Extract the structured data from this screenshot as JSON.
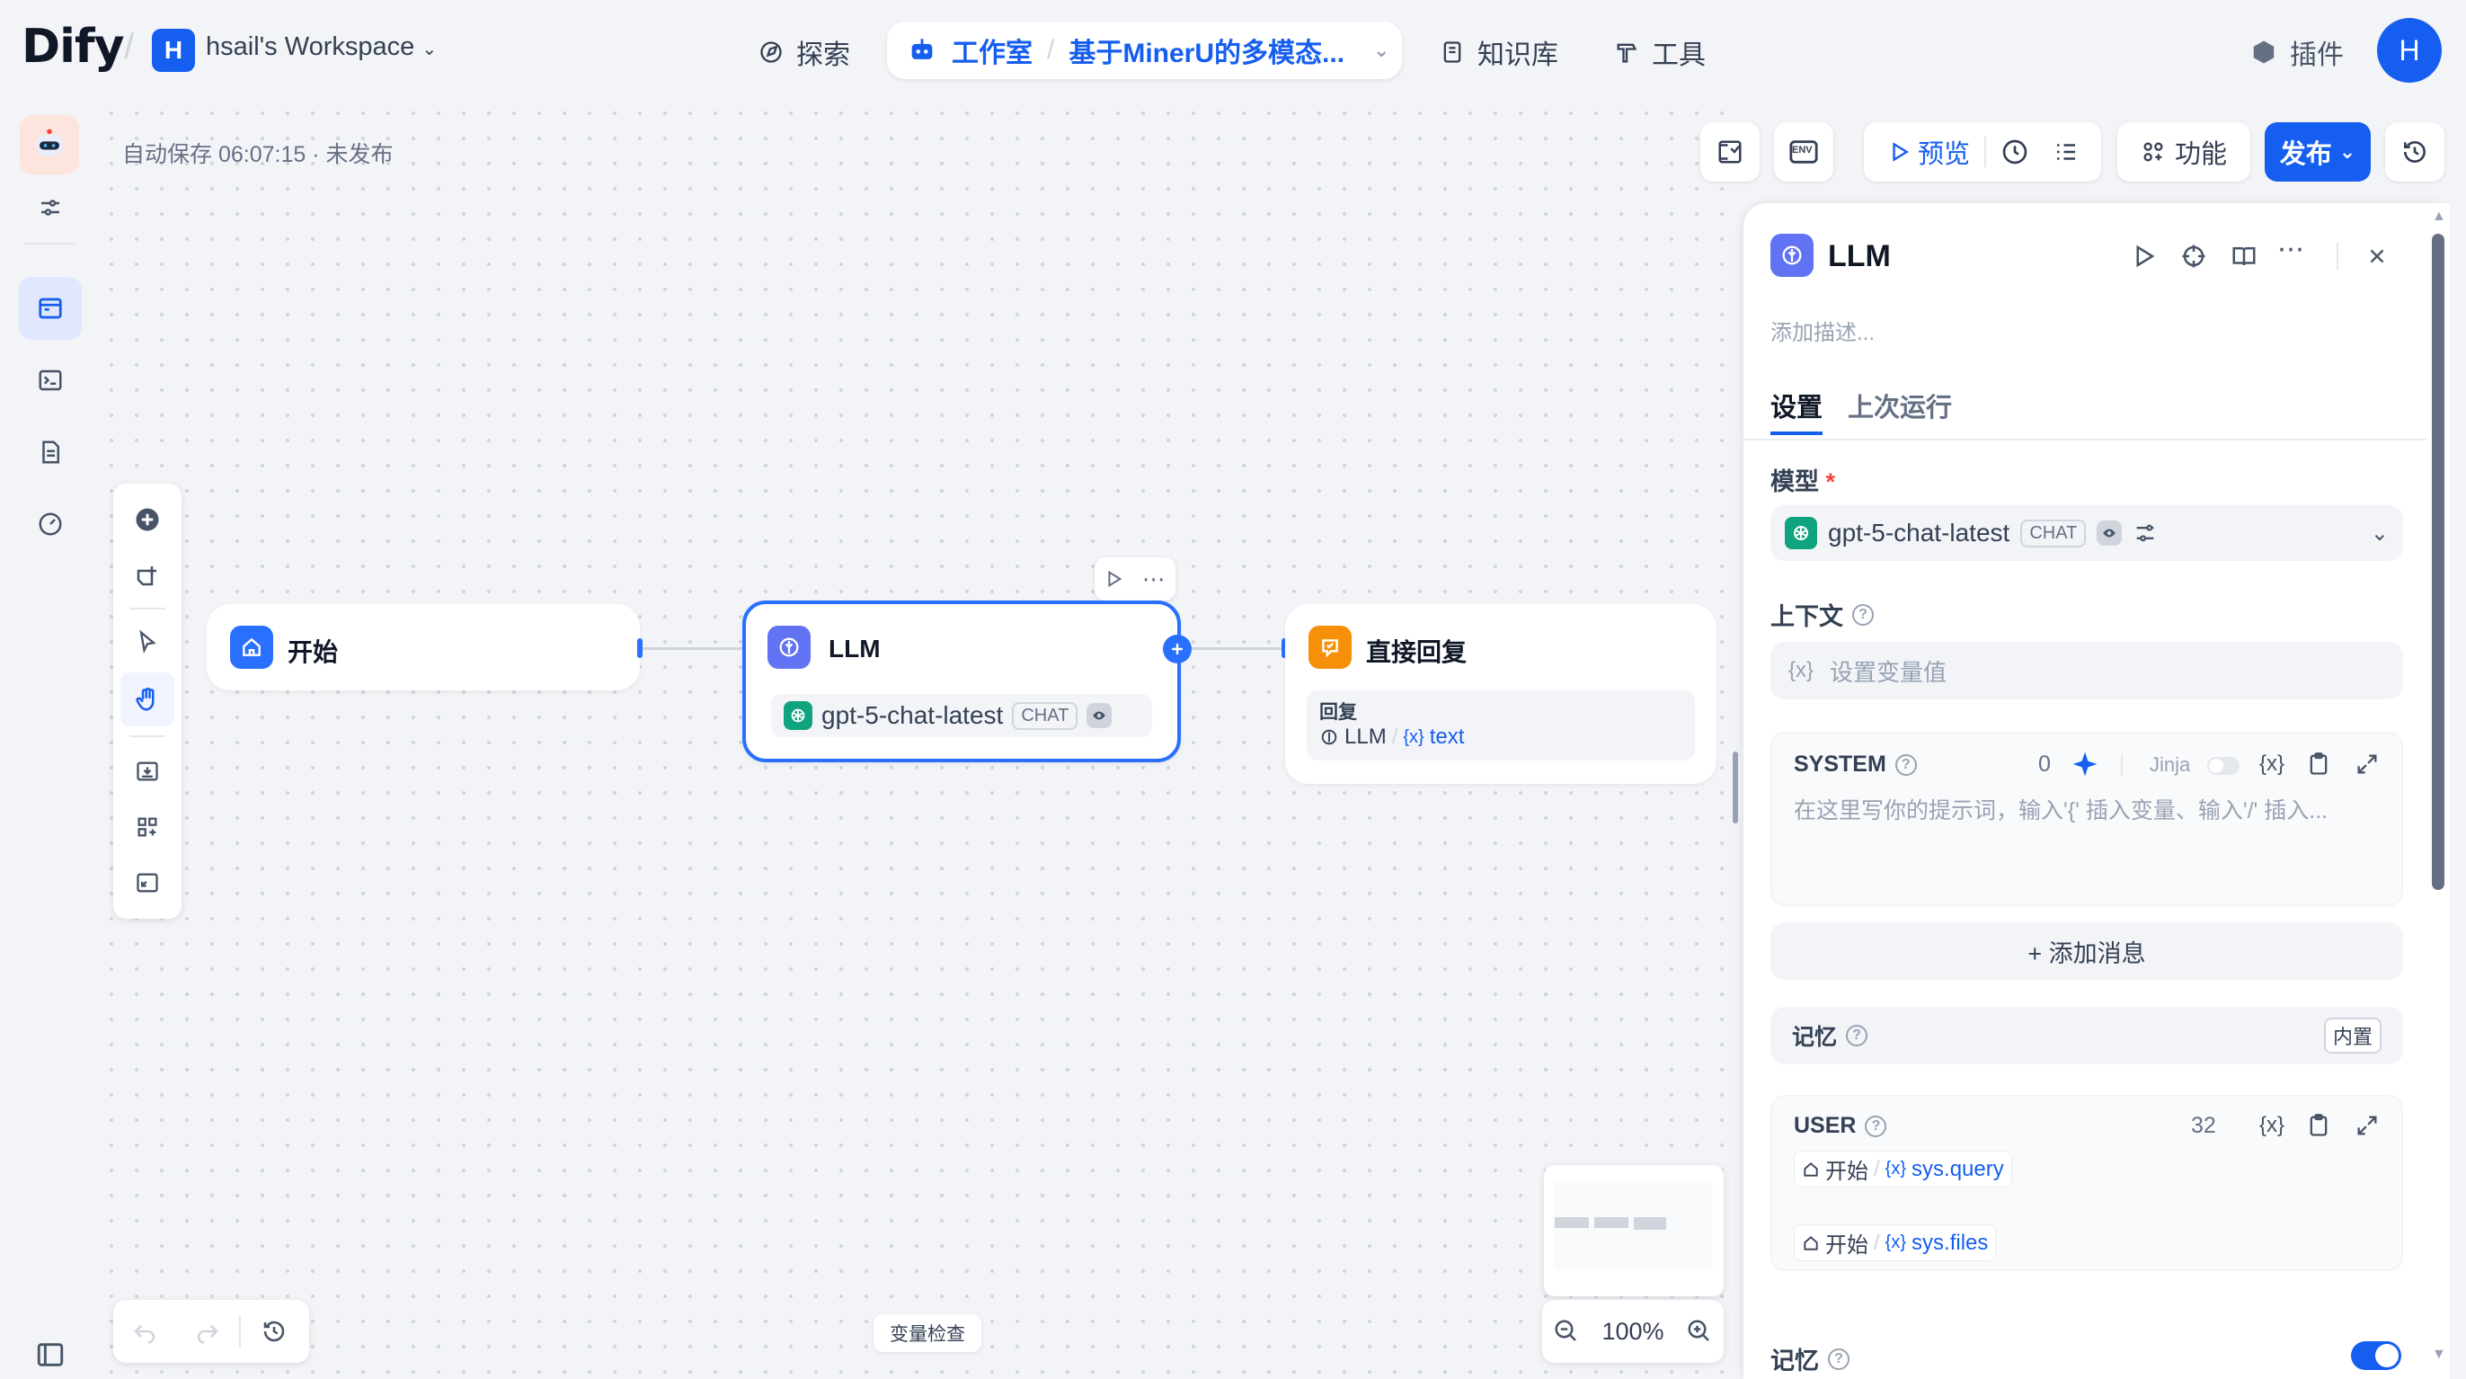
{
  "app": {
    "logo": "Dify",
    "workspace_initial": "H",
    "workspace_name": "hsail's Workspace"
  },
  "nav": {
    "explore": "探索",
    "studio": "工作室",
    "app_name": "基于MinerU的多模态...",
    "knowledge": "知识库",
    "tools": "工具",
    "plugins": "插件",
    "user_initial": "H"
  },
  "canvas": {
    "autosave": "自动保存 06:07:15 · 未发布",
    "nodes": {
      "start": {
        "title": "开始"
      },
      "llm": {
        "title": "LLM",
        "model": "gpt-5-chat-latest",
        "tag": "CHAT"
      },
      "reply": {
        "title": "直接回复",
        "reply_label": "回复",
        "ref_node": "LLM",
        "ref_var": "text"
      }
    },
    "var_inspect": "变量检查",
    "zoom": "100%"
  },
  "toolbar": {
    "env_label": "ENV",
    "preview": "预览",
    "features": "功能",
    "publish": "发布"
  },
  "panel": {
    "title": "LLM",
    "description_placeholder": "添加描述...",
    "tabs": [
      "设置",
      "上次运行"
    ],
    "model_label": "模型",
    "required_mark": "*",
    "model_name": "gpt-5-chat-latest",
    "model_tag": "CHAT",
    "context_label": "上下文",
    "context_placeholder": "设置变量值",
    "var_icon": "{x}",
    "system": {
      "label": "SYSTEM",
      "count": "0",
      "jinja": "Jinja",
      "placeholder": "在这里写你的提示词，输入'{' 插入变量、输入'/' 插入..."
    },
    "add_message": "+ 添加消息",
    "memory_label": "记忆",
    "memory_badge": "内置",
    "user": {
      "label": "USER",
      "count": "32",
      "refs": [
        {
          "node": "开始",
          "var": "sys.query"
        },
        {
          "node": "开始",
          "var": "sys.files"
        }
      ]
    },
    "memory_label_2": "记忆"
  },
  "colors": {
    "accent": "#155eef",
    "start_node": "#2970ff",
    "llm_node": "#6172f3",
    "reply_node": "#f79009",
    "openai": "#10a37f"
  }
}
